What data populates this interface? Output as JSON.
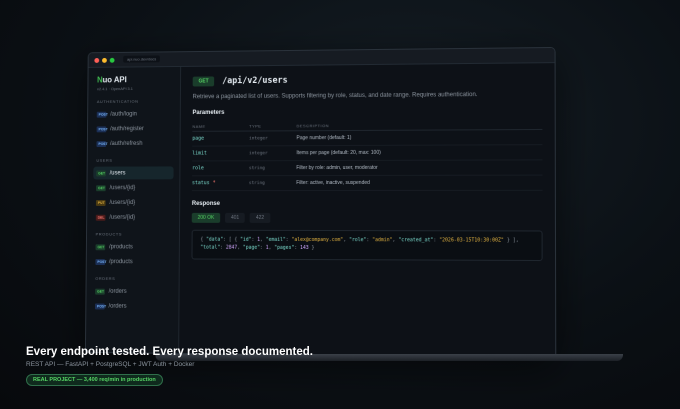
{
  "window": {
    "url": "api.nuo.dev/docs"
  },
  "sidebar": {
    "brand_prefix": "N",
    "brand_rest": "uo API",
    "version": "v2.4.1 · OpenAPI 3.1",
    "sections": {
      "auth": "AUTHENTICATION",
      "users": "USERS",
      "products": "PRODUCTS",
      "orders": "ORDERS"
    },
    "items": [
      {
        "method": "POST",
        "path": "/auth/login"
      },
      {
        "method": "POST",
        "path": "/auth/register"
      },
      {
        "method": "POST",
        "path": "/auth/refresh"
      },
      {
        "method": "GET",
        "path": "/users"
      },
      {
        "method": "GET",
        "path": "/users/{id}"
      },
      {
        "method": "PUT",
        "path": "/users/{id}"
      },
      {
        "method": "DEL",
        "path": "/users/{id}"
      },
      {
        "method": "GET",
        "path": "/products"
      },
      {
        "method": "POST",
        "path": "/products"
      },
      {
        "method": "GET",
        "path": "/orders"
      },
      {
        "method": "POST",
        "path": "/orders"
      }
    ]
  },
  "endpoint": {
    "method": "GET",
    "path": "/api/v2/users",
    "description": "Retrieve a paginated list of users. Supports filtering by role, status, and date range. Requires authentication."
  },
  "parameters": {
    "title": "Parameters",
    "headers": {
      "name": "NAME",
      "type": "TYPE",
      "description": "DESCRIPTION"
    },
    "rows": [
      {
        "name": "page",
        "type": "integer",
        "description": "Page number (default: 1)"
      },
      {
        "name": "limit",
        "type": "integer",
        "description": "Items per page (default: 20, max: 100)"
      },
      {
        "name": "role",
        "type": "string",
        "description": "Filter by role: admin, user, moderator"
      },
      {
        "name": "status",
        "required": "*",
        "type": "string",
        "description": "Filter: active, inactive, suspended"
      }
    ]
  },
  "response": {
    "title": "Response",
    "tabs": [
      "200 OK",
      "401",
      "422"
    ],
    "code": {
      "open": "{ ",
      "k_data": "\"data\"",
      "p1": ": [ { ",
      "k_id": "\"id\"",
      "v_id": "1",
      "k_email": "\"email\"",
      "v_email": "\"alex@company.com\"",
      "k_role": "\"role\"",
      "v_role": "\"admin\"",
      "k_created": "\"created_at\"",
      "v_created": "\"2026-03-15T10:30:00Z\"",
      "p2": " } ], ",
      "k_total": "\"total\"",
      "v_total": "2847",
      "k_page": "\"page\"",
      "v_page": "1",
      "k_pages": "\"pages\"",
      "v_pages": "143",
      "close": " }"
    }
  },
  "caption": {
    "headline": "Every endpoint tested. Every response documented.",
    "sub": "REST API — FastAPI + PostgreSQL + JWT Auth + Docker",
    "pill": "REAL PROJECT — 3,400 req/min in production"
  }
}
